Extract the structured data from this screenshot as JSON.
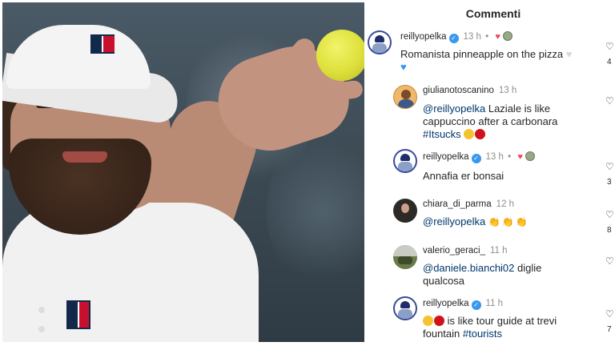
{
  "panel": {
    "title": "Commenti"
  },
  "comments": [
    {
      "user": "reillyopelka",
      "verified": true,
      "time": "13 h",
      "dot": "•",
      "text_lines": [
        "Romanista pinneapple on the pizza"
      ],
      "side_count": "4"
    },
    {
      "user": "giulianotoscanino",
      "time": "13 h",
      "mention": "@reillyopelka",
      "line1_rest": " Laziale is like",
      "line2": "cappuccino after a carbonara",
      "hashtag": "#Itsucks",
      "side_count": ""
    },
    {
      "user": "reillyopelka",
      "verified": true,
      "time": "13 h",
      "dot": "•",
      "text": "Annafia er bonsai",
      "side_count": "3"
    },
    {
      "user": "chiara_di_parma",
      "time": "12 h",
      "mention": "@reillyopelka",
      "side_count": "8"
    },
    {
      "user": "valerio_geraci_",
      "time": "11 h",
      "mention": "@daniele.bianchi02",
      "line1_rest": " diglie",
      "line2": "qualcosa",
      "side_count": ""
    },
    {
      "user": "reillyopelka",
      "verified": true,
      "time": "11 h",
      "line1_rest": " is like tour guide at trevi",
      "line2": "fountain ",
      "hashtag": "#tourists",
      "side_count": "7"
    }
  ],
  "icons": {
    "heart": "heart-icon",
    "verified": "verified-badge-icon"
  },
  "colors": {
    "link": "#00376b",
    "verified": "#3897f0",
    "heart": "#ed4956",
    "muted": "#8e8e8e"
  }
}
